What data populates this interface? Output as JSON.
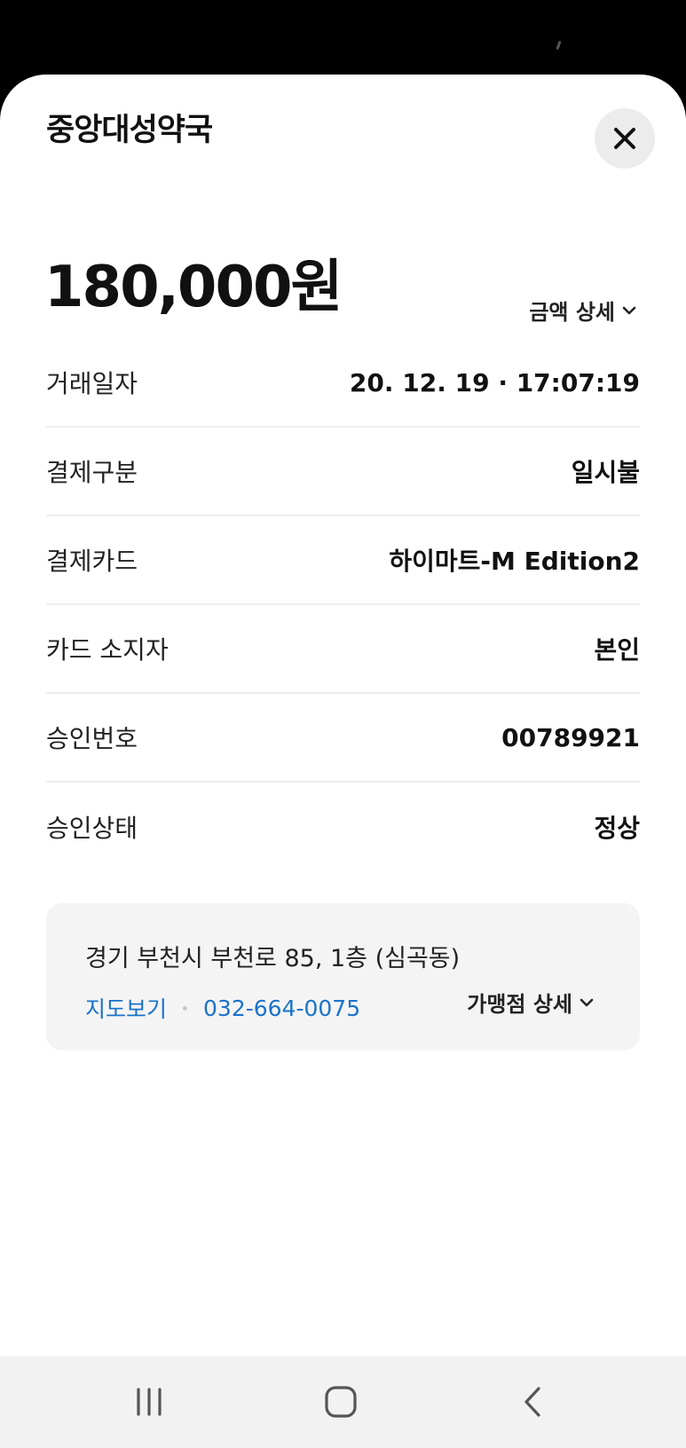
{
  "header": {
    "merchant_name": "중앙대성약국",
    "close_icon": "close-icon"
  },
  "summary": {
    "amount": "180,000원",
    "amount_detail_label": "금액 상세"
  },
  "details": [
    {
      "label": "거래일자",
      "value": "20. 12. 19 · 17:07:19"
    },
    {
      "label": "결제구분",
      "value": "일시불"
    },
    {
      "label": "결제카드",
      "value": "하이마트-M Edition2"
    },
    {
      "label": "카드 소지자",
      "value": "본인"
    },
    {
      "label": "승인번호",
      "value": "00789921"
    },
    {
      "label": "승인상태",
      "value": "정상"
    }
  ],
  "store": {
    "address": "경기 부천시 부천로 85, 1층 (심곡동)",
    "map_label": "지도보기",
    "phone": "032-664-0075",
    "detail_label": "가맹점 상세"
  },
  "navbar": {
    "recents_icon": "recents-icon",
    "home_icon": "home-icon",
    "back_icon": "back-icon"
  },
  "colors": {
    "link": "#1a73c9",
    "card_background": "#f4f4f5",
    "close_button_background": "#ececec",
    "navbar_background": "#f2f2f2"
  }
}
